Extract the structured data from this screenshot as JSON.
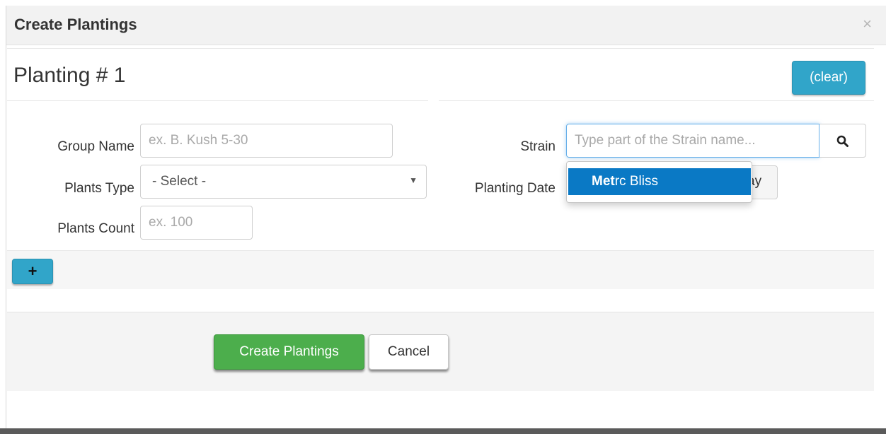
{
  "modal": {
    "title": "Create Plantings",
    "close_symbol": "×"
  },
  "planting": {
    "heading": "Planting # 1",
    "clear_label": "(clear)"
  },
  "form": {
    "group_name": {
      "label": "Group Name",
      "placeholder": "ex. B. Kush 5-30",
      "value": ""
    },
    "plants_type": {
      "label": "Plants Type",
      "selected": "- Select -",
      "caret": "▼"
    },
    "plants_count": {
      "label": "Plants Count",
      "placeholder": "ex. 100",
      "value": ""
    },
    "strain": {
      "label": "Strain",
      "placeholder": "Type part of the Strain name...",
      "value": "",
      "search_icon": "search-icon"
    },
    "planting_date": {
      "label": "Planting Date",
      "today_partial": "ay"
    }
  },
  "autocomplete": {
    "items": [
      {
        "match": "Met",
        "rest": "rc Bliss"
      }
    ]
  },
  "add_button": {
    "symbol": "+"
  },
  "footer": {
    "create_label": "Create Plantings",
    "cancel_label": "Cancel"
  },
  "colors": {
    "info": "#31a5c9",
    "success": "#4cae4c",
    "highlight": "#0a79c5"
  }
}
